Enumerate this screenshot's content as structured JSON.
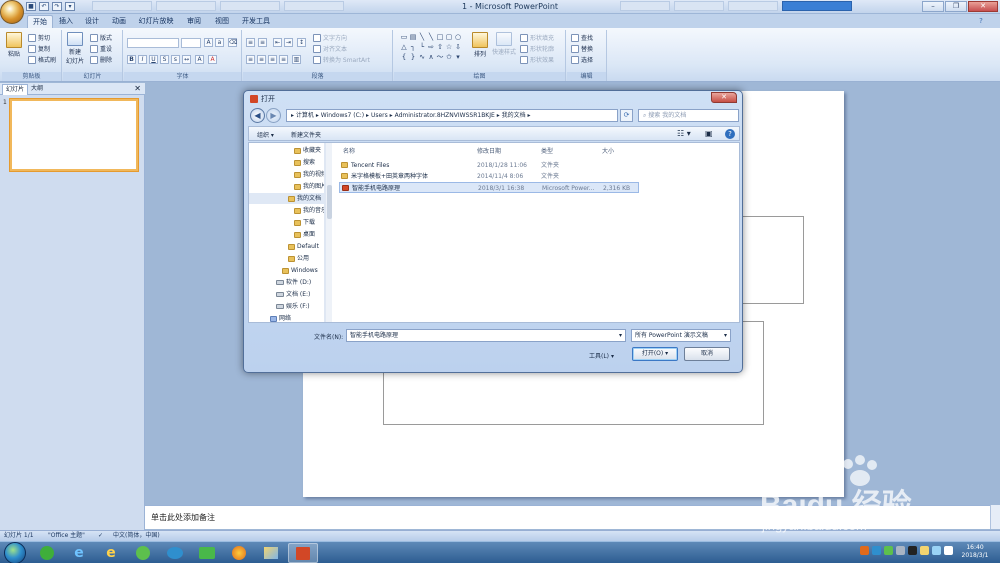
{
  "app": {
    "title": "1 - Microsoft PowerPoint"
  },
  "qat": {
    "save": "",
    "undo": "",
    "redo": ""
  },
  "taskbar_thumbs": [
    "",
    "",
    "",
    "",
    "",
    ""
  ],
  "tabs": [
    "开始",
    "插入",
    "设计",
    "动画",
    "幻灯片放映",
    "审阅",
    "视图",
    "开发工具"
  ],
  "ribbon": {
    "clipboard": {
      "label": "剪贴板",
      "paste": "粘贴",
      "cut": "剪切",
      "copy": "复制",
      "format_painter": "格式刷"
    },
    "slides": {
      "label": "幻灯片",
      "new_slide": "新建\n幻灯片",
      "layout": "版式",
      "reset": "重设",
      "delete": "删除"
    },
    "font": {
      "label": "字体"
    },
    "paragraph": {
      "label": "段落",
      "text_direction": "文字方向",
      "align_text": "对齐文本",
      "smartart": "转换为 SmartArt"
    },
    "drawing": {
      "label": "绘图",
      "arrange": "排列",
      "quick_styles": "快速样式",
      "shape_fill": "形状填充",
      "shape_outline": "形状轮廓",
      "shape_effects": "形状效果"
    },
    "editing": {
      "label": "编辑",
      "find": "查找",
      "replace": "替换",
      "select": "选择"
    }
  },
  "left_pane": {
    "tab_slides": "幻灯片",
    "tab_outline": "大纲",
    "slide_number": "1"
  },
  "notes": {
    "placeholder": "单击此处添加备注"
  },
  "status": {
    "slide": "幻灯片 1/1",
    "theme": "\"Office 主题\"",
    "language": "中文(简体，中国)"
  },
  "clock": {
    "time": "16:40",
    "date": "2018/3/1"
  },
  "watermark": {
    "brand": "Baidu 经验",
    "url": "jingyan.baidu.com"
  },
  "dialog": {
    "title": "打开",
    "address": [
      "计算机",
      "Windows7 (C:)",
      "Users",
      "Administrator.8HZNVIWSSR1BKJE",
      "我的文档"
    ],
    "search_placeholder": "搜索 我的文档",
    "toolbar": {
      "organize": "组织",
      "new_folder": "新建文件夹"
    },
    "tree": [
      {
        "name": "收藏夹",
        "indent": 3,
        "kind": "folder"
      },
      {
        "name": "搜索",
        "indent": 3,
        "kind": "folder"
      },
      {
        "name": "我的视频",
        "indent": 3,
        "kind": "folder"
      },
      {
        "name": "我的图片",
        "indent": 3,
        "kind": "folder"
      },
      {
        "name": "我的文档",
        "indent": 3,
        "kind": "folder",
        "selected": true
      },
      {
        "name": "我的音乐",
        "indent": 3,
        "kind": "folder"
      },
      {
        "name": "下载",
        "indent": 3,
        "kind": "folder"
      },
      {
        "name": "桌面",
        "indent": 3,
        "kind": "folder"
      },
      {
        "name": "Default",
        "indent": 2,
        "kind": "folder"
      },
      {
        "name": "公用",
        "indent": 2,
        "kind": "folder"
      },
      {
        "name": "Windows",
        "indent": 1,
        "kind": "folder"
      },
      {
        "name": "软件 (D:)",
        "indent": 0,
        "kind": "drive"
      },
      {
        "name": "文档 (E:)",
        "indent": 0,
        "kind": "drive"
      },
      {
        "name": "娱乐 (F:)",
        "indent": 0,
        "kind": "drive"
      },
      {
        "name": "网络",
        "indent": -1,
        "kind": "network"
      }
    ],
    "columns": {
      "name": "名称",
      "date": "修改日期",
      "type": "类型",
      "size": "大小"
    },
    "files": [
      {
        "name": "Tencent Files",
        "date": "2018/1/28 11:06",
        "type": "文件夹",
        "size": "",
        "icon": "folder"
      },
      {
        "name": "米字格模板+田英章两种字体",
        "date": "2014/11/4 8:06",
        "type": "文件夹",
        "size": "",
        "icon": "folder"
      },
      {
        "name": "智能手机电路原理",
        "date": "2018/3/1 16:38",
        "type": "Microsoft Power...",
        "size": "2,316 KB",
        "icon": "ppt",
        "selected": true
      }
    ],
    "filename_label": "文件名(N):",
    "filename_value": "智能手机电路原理",
    "filter": "所有 PowerPoint 演示文稿",
    "tools": "工具(L)",
    "open": "打开(O)",
    "cancel": "取消"
  }
}
